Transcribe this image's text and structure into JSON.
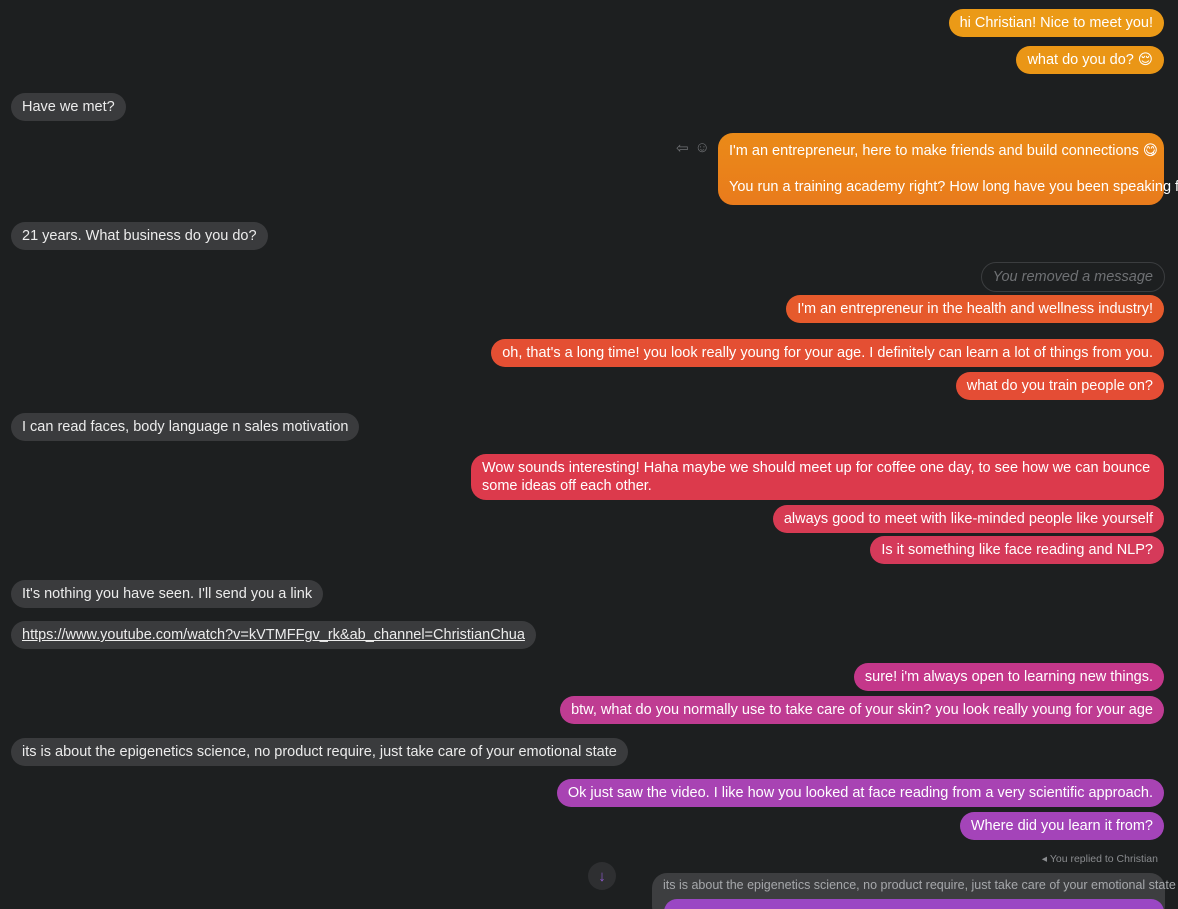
{
  "messages": [
    {
      "id": "m1",
      "side": "out",
      "text": "hi Christian! Nice to meet you!",
      "color": "#eb9a17"
    },
    {
      "id": "m2",
      "side": "out",
      "text": "what do you do? 😌",
      "color": "#ea9616"
    },
    {
      "id": "m3",
      "side": "in",
      "text": "Have we met?"
    },
    {
      "id": "m4",
      "side": "out",
      "text_line1": "I'm an entrepreneur, here to make friends and build connections 😋",
      "text_line2": "You run a training academy right? How long have you been speaking for",
      "color": "#ea8518"
    },
    {
      "id": "m5",
      "side": "in",
      "text": "21 years. What business do you do?"
    },
    {
      "id": "m6",
      "side": "out",
      "text": "You removed a message",
      "removed": true
    },
    {
      "id": "m7",
      "side": "out",
      "text": "I'm an entrepreneur in the health and wellness industry!",
      "color": "#e65a2c"
    },
    {
      "id": "m8",
      "side": "out",
      "text": "oh, that's a long time! you look really young for your age. I definitely can learn a lot of things from you.",
      "color": "#e44f33"
    },
    {
      "id": "m9",
      "side": "out",
      "text": "what do you train people on?",
      "color": "#e44d35"
    },
    {
      "id": "m10",
      "side": "in",
      "text": "I can read faces, body language n sales motivation"
    },
    {
      "id": "m11",
      "side": "out",
      "text": "Wow sounds interesting! Haha maybe we should meet up for coffee one day, to see how we can bounce some ideas off each other.",
      "color": "#dc3a4c"
    },
    {
      "id": "m12",
      "side": "out",
      "text": "always good to meet with like-minded people like yourself",
      "color": "#d73b53"
    },
    {
      "id": "m13",
      "side": "out",
      "text": "Is it something like face reading and NLP?",
      "color": "#d53a5a"
    },
    {
      "id": "m14",
      "side": "in",
      "text": "It's nothing you have seen. I'll send you a link"
    },
    {
      "id": "m15",
      "side": "in",
      "text": "https://www.youtube.com/watch?v=kVTMFFgv_rk&ab_channel=ChristianChua",
      "link": true
    },
    {
      "id": "m16",
      "side": "out",
      "text": "sure! i'm always open to learning new things.",
      "color": "#c4378a"
    },
    {
      "id": "m17",
      "side": "out",
      "text": "btw, what do you normally use to take care of your skin? you look really young for your age",
      "color": "#bf3c92"
    },
    {
      "id": "m18",
      "side": "in",
      "text": "its is about the epigenetics science, no product require, just take care of your emotional state"
    },
    {
      "id": "m19",
      "side": "out",
      "text": "Ok just saw the video. I like how you looked at face reading from a very scientific approach.",
      "color": "#a843b3"
    },
    {
      "id": "m20",
      "side": "out",
      "text": "Where did you learn it from?",
      "color": "#a444b9"
    }
  ],
  "reply": {
    "label": "You replied to Christian",
    "quoted_text": "its is about the epigenetics science, no product require, just take care of your emotional state",
    "reply_color": "#9a47c4"
  },
  "icons": {
    "reply": "reply-arrow-icon",
    "emoji": "smiley-icon",
    "scroll_down": "arrow-down-icon"
  },
  "glyphs": {
    "reply": "⇦",
    "emoji": "☺",
    "scroll_down": "↓",
    "reply_small": "◂"
  }
}
